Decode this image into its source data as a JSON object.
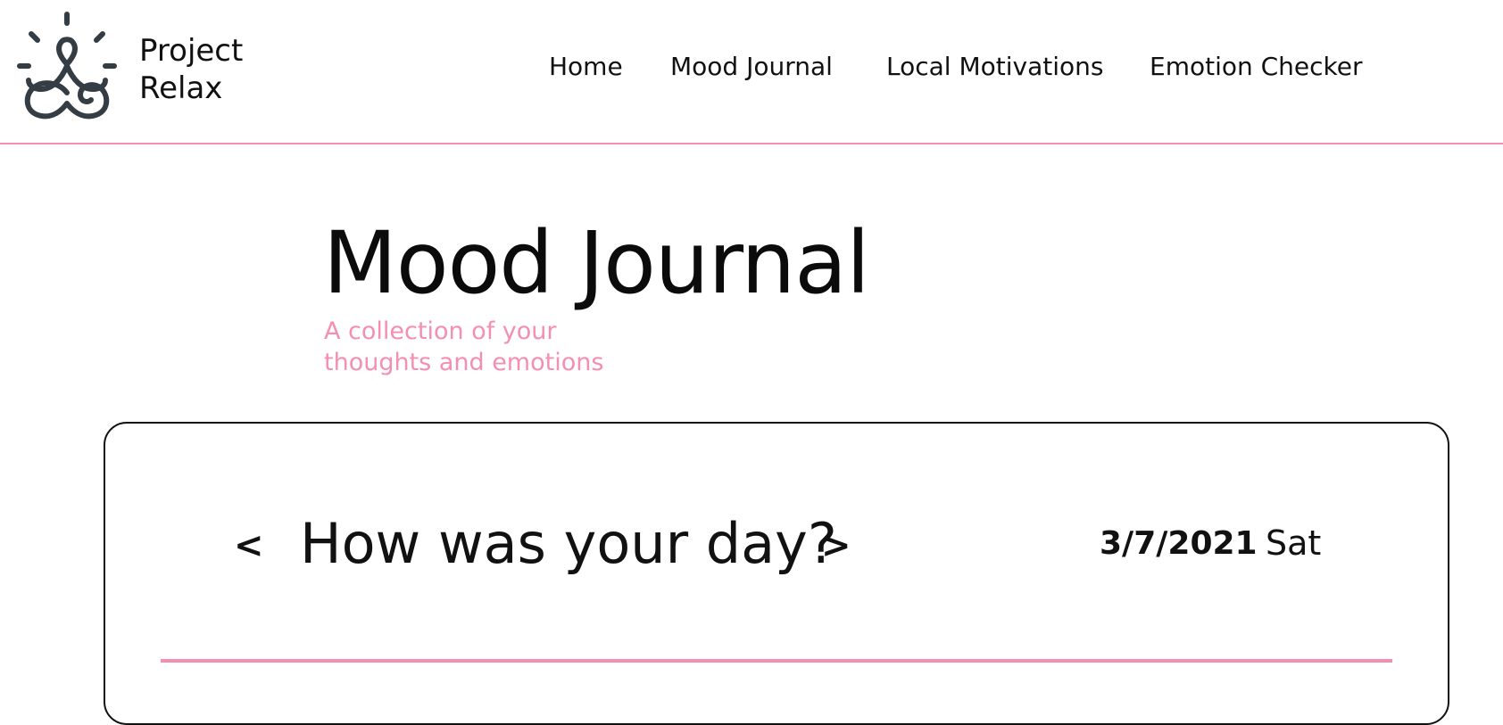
{
  "header": {
    "brand_line1": "Project",
    "brand_line2": "Relax",
    "logo_icon": "meditation-figure-icon",
    "nav": {
      "home": "Home",
      "mood_journal": "Mood Journal",
      "local_motivations": "Local Motivations",
      "emotion_checker": "Emotion Checker"
    }
  },
  "hero": {
    "title": "Mood Journal",
    "subtitle_line1": "A collection of your",
    "subtitle_line2": "thoughts and emotions"
  },
  "journal": {
    "prev_label": "<",
    "next_label": ">",
    "question": "How was your day?",
    "date": "3/7/2021",
    "day": "Sat"
  },
  "colors": {
    "accent": "#f48fb1",
    "text": "#111111",
    "logo": "#343c44",
    "background": "#ffffff"
  }
}
